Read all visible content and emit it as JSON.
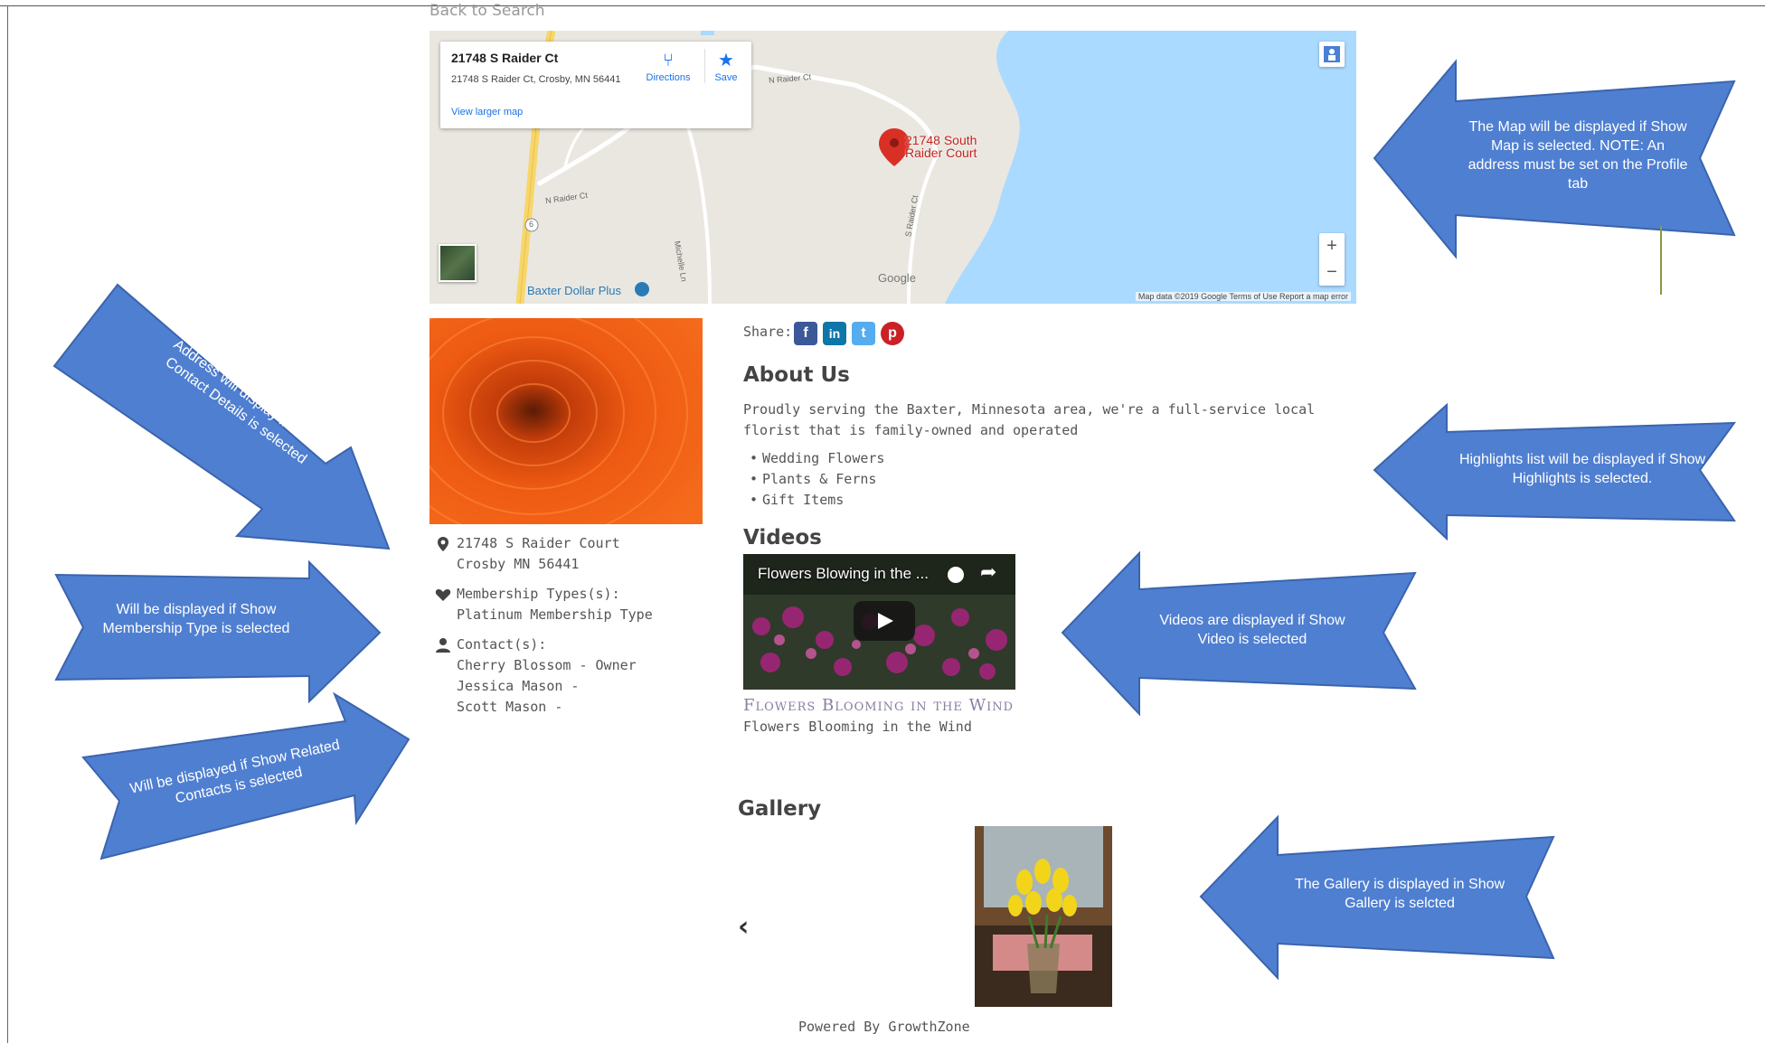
{
  "back_link": "Back to Search",
  "map": {
    "card_title": "21748 S Raider Ct",
    "card_address": "21748 S Raider Ct, Crosby, MN 56441",
    "directions": "Directions",
    "save": "Save",
    "view_larger": "View larger map",
    "pin_label_1": "21748 South",
    "pin_label_2": "Raider Court",
    "poi": "Baxter Dollar Plus",
    "road_raider": "N Raider Ct",
    "road_raider2": "N Raider Ct",
    "road_sraider": "S Raider Ct",
    "road_michelle": "Michelle Ln",
    "road_hwy": "6",
    "google": "Google",
    "attribution": "Map data ©2019 Google   Terms of Use   Report a map error",
    "zoom_in": "+",
    "zoom_out": "−"
  },
  "details": {
    "address_line1": "21748 S Raider Court",
    "address_line2": "Crosby MN 56441",
    "membership_label": "Membership Types(s):",
    "membership_value": "Platinum Membership Type",
    "contacts_label": "Contact(s):",
    "contacts": [
      "Cherry Blossom - Owner",
      "Jessica Mason -",
      "Scott Mason -"
    ]
  },
  "share": {
    "label": "Share:",
    "facebook": "f",
    "linkedin": "in",
    "twitter": "t",
    "pinterest": "p"
  },
  "about": {
    "heading": "About Us",
    "text": "Proudly serving the Baxter, Minnesota area, we're a full-service local florist that is family-owned and operated",
    "highlights": [
      "Wedding Flowers",
      "Plants & Ferns",
      "Gift Items"
    ]
  },
  "videos": {
    "heading": "Videos",
    "overlay_title": "Flowers Blowing in the ...",
    "caption_title": "Flowers Blooming in the Wind",
    "caption": "Flowers Blooming in the Wind"
  },
  "gallery": {
    "heading": "Gallery",
    "prev": "‹"
  },
  "footer": "Powered By GrowthZone",
  "callouts": {
    "map": "The Map will be displayed if Show Map is selected. NOTE: An address must be set on the Profile tab",
    "highlights": "Highlights list will be displayed if Show Highlights is selected.",
    "videos": "Videos are displayed if Show Video is selected",
    "gallery": "The Gallery is displayed in Show Gallery is selcted",
    "address": "Address will display if Show Contact Details is selected",
    "membership": "Will be displayed if Show Membership Type is selected",
    "contacts": "Will be displayed if Show Related Contacts is selected"
  },
  "colors": {
    "callout_fill": "#4f7fd1",
    "callout_stroke": "#3b64ad",
    "facebook": "#3b5998",
    "linkedin": "#0e76a8",
    "twitter": "#55acee",
    "pinterest": "#cb2027",
    "water": "#aadaff"
  }
}
